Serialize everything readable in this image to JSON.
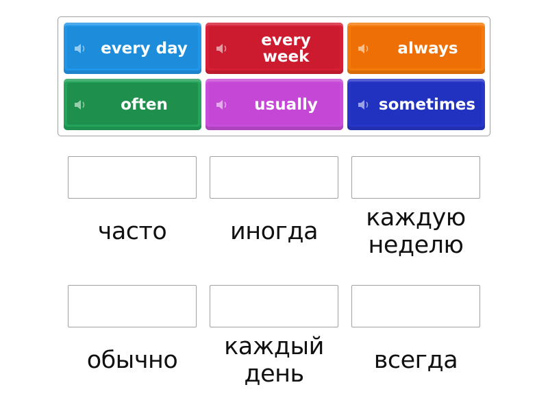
{
  "tiles": [
    {
      "label": "every day",
      "color": "#2196e8",
      "icon": "speaker-icon"
    },
    {
      "label": "every week",
      "color": "#d61f35",
      "icon": "speaker-icon"
    },
    {
      "label": "always",
      "color": "#f47a0c",
      "icon": "speaker-icon"
    },
    {
      "label": "often",
      "color": "#24a35a",
      "icon": "speaker-icon"
    },
    {
      "label": "usually",
      "color": "#c74ed8",
      "icon": "speaker-icon"
    },
    {
      "label": "sometimes",
      "color": "#2736c8",
      "icon": "speaker-icon"
    }
  ],
  "targets": [
    {
      "label": "часто",
      "answer": ""
    },
    {
      "label": "иногда",
      "answer": ""
    },
    {
      "label": "каждую неделю",
      "answer": ""
    },
    {
      "label": "обычно",
      "answer": ""
    },
    {
      "label": "каждый день",
      "answer": ""
    },
    {
      "label": "всегда",
      "answer": ""
    }
  ]
}
